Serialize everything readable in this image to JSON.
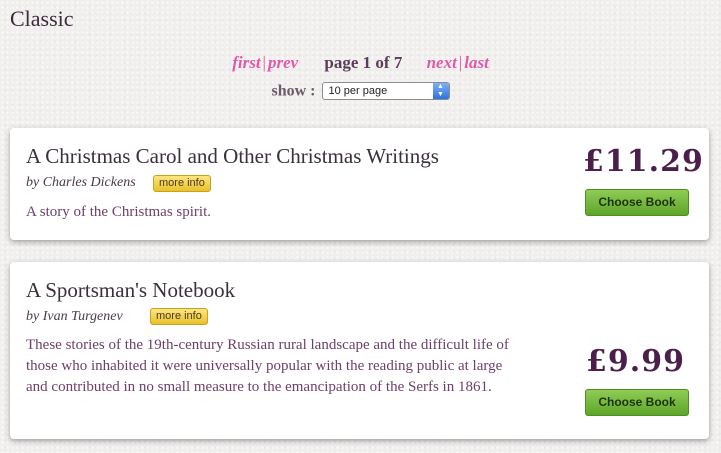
{
  "page": {
    "title": "Classic"
  },
  "pagination": {
    "first": "first",
    "prev": "prev",
    "separator": "|",
    "info": "page 1 of 7",
    "next": "next",
    "last": "last",
    "show_label": "show :",
    "per_page_selected": "10 per page"
  },
  "books": [
    {
      "title": "A Christmas Carol and Other Christmas Writings",
      "author": "by Charles Dickens",
      "more_info": "more info",
      "description": "A story of the Christmas spirit.",
      "price": "£11.29",
      "button": "Choose Book"
    },
    {
      "title": "A Sportsman's Notebook",
      "author": "by Ivan Turgenev",
      "more_info": "more info",
      "description": "These stories of the 19th-century Russian rural landscape and the difficult life of those who inhabited it were universally popular with the reading public at large and contributed in no small measure to the emancipation of the Serfs in 1861.",
      "price": "£9.99",
      "button": "Choose Book"
    }
  ],
  "colors": {
    "link_pink": "#df5aa6",
    "price_purple": "#4b1f4a",
    "button_green": "#6db33a",
    "more_info_yellow": "#f2d24a"
  }
}
